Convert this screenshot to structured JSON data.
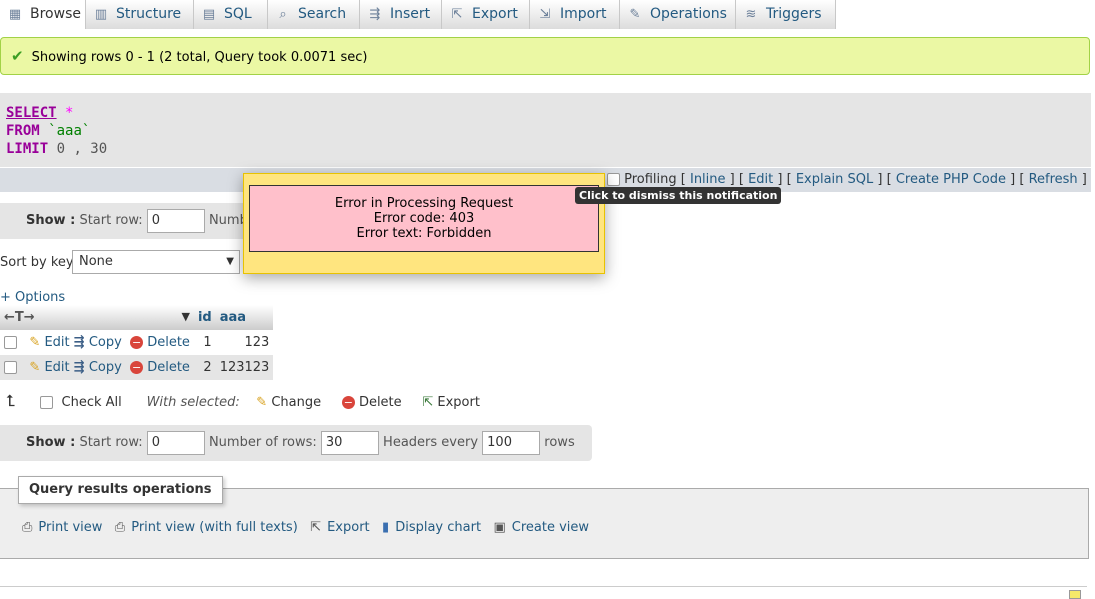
{
  "tabs": [
    {
      "label": "Browse",
      "icon": "browse-icon",
      "glyph": "▦"
    },
    {
      "label": "Structure",
      "icon": "structure-icon",
      "glyph": "▥"
    },
    {
      "label": "SQL",
      "icon": "sql-icon",
      "glyph": "▤"
    },
    {
      "label": "Search",
      "icon": "search-icon",
      "glyph": "🔍"
    },
    {
      "label": "Insert",
      "icon": "insert-icon",
      "glyph": "⇶"
    },
    {
      "label": "Export",
      "icon": "export-icon",
      "glyph": "⇱"
    },
    {
      "label": "Import",
      "icon": "import-icon",
      "glyph": "⇲"
    },
    {
      "label": "Operations",
      "icon": "operations-icon",
      "glyph": "🔧"
    },
    {
      "label": "Triggers",
      "icon": "triggers-icon",
      "glyph": "≋"
    }
  ],
  "success_message": "Showing rows 0 - 1 (2 total, Query took 0.0071 sec)",
  "sql": {
    "line1_kw": "SELECT",
    "line1_rest": "*",
    "line2_kw": "FROM",
    "line2_rest": "`aaa`",
    "line3_kw": "LIMIT",
    "line3_rest": "0 , 30"
  },
  "sql_links": {
    "profiling": "Profiling",
    "inline": "Inline",
    "edit": "Edit",
    "explain": "Explain SQL",
    "php": "Create PHP Code",
    "refresh": "Refresh"
  },
  "show_bar_top": {
    "show": "Show :",
    "start_row_label": "Start row:",
    "start_row": "0",
    "rows_label_partial": "Numbe"
  },
  "sort": {
    "label": "Sort by key:",
    "value": "None"
  },
  "options_link": "+ Options",
  "table": {
    "headers": {
      "id": "id",
      "aaa": "aaa"
    },
    "rows": [
      {
        "edit": "Edit",
        "copy": "Copy",
        "delete": "Delete",
        "id": "1",
        "aaa": "123"
      },
      {
        "edit": "Edit",
        "copy": "Copy",
        "delete": "Delete",
        "id": "2",
        "aaa": "123123"
      }
    ]
  },
  "bulk": {
    "check_all": "Check All",
    "with_selected": "With selected:",
    "change": "Change",
    "delete": "Delete",
    "export": "Export"
  },
  "show_bar_bottom": {
    "show": "Show :",
    "start_row_label": "Start row:",
    "start_row": "0",
    "num_rows_label": "Number of rows:",
    "num_rows": "30",
    "headers_every_label": "Headers every",
    "headers_every": "100",
    "rows_label": "rows"
  },
  "error": {
    "title": "Error in Processing Request",
    "code": "Error code: 403",
    "text": "Error text: Forbidden",
    "tooltip": "Click to dismiss this notification"
  },
  "qro": {
    "legend": "Query results operations",
    "print_view": "Print view",
    "print_view_full": "Print view (with full texts)",
    "export": "Export",
    "display_chart": "Display chart",
    "create_view": "Create view"
  },
  "colors": {
    "success_bg": "#ebf8a4",
    "error_bg": "#ffc0cb",
    "error_wrap": "#ffe57f",
    "link": "#235a81"
  }
}
